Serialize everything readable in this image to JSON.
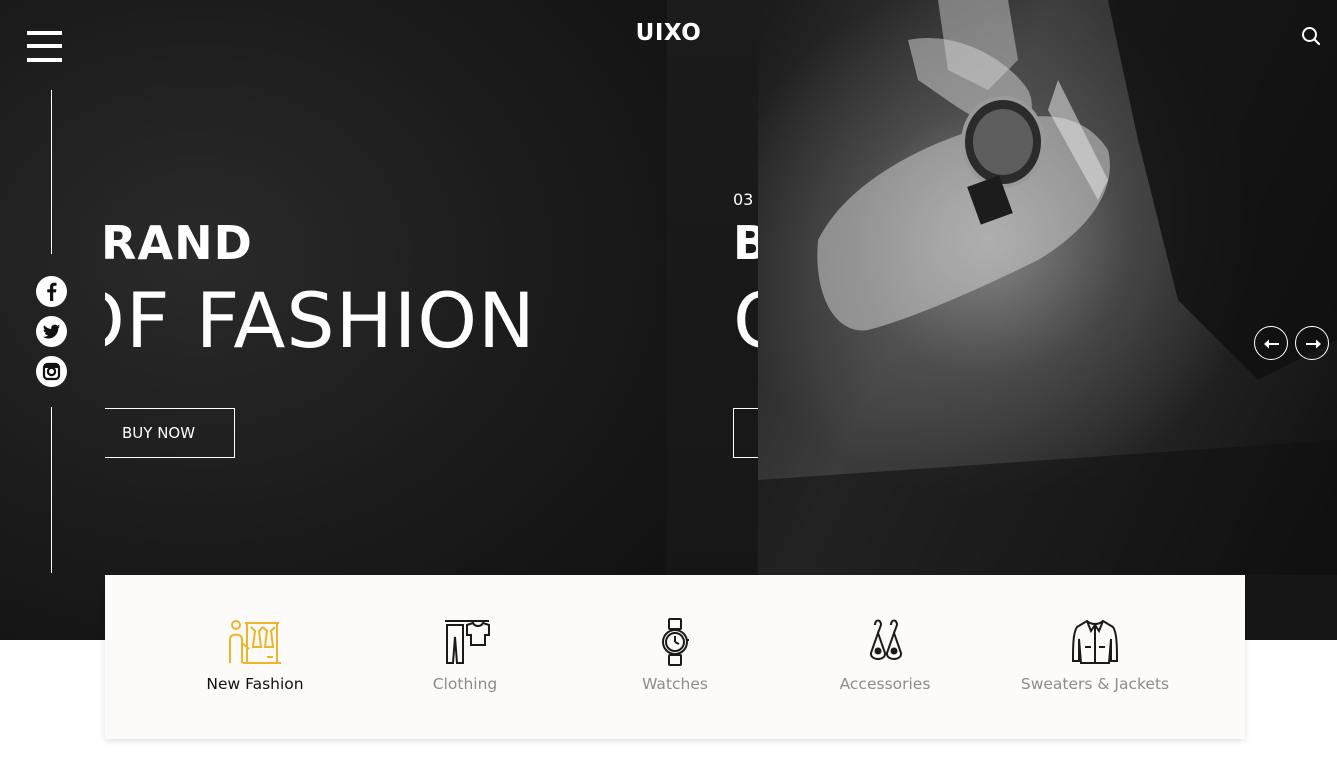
{
  "header": {
    "logo": "UIXO",
    "menu_icon": "hamburger-menu-icon",
    "search_icon": "search-icon"
  },
  "social": [
    {
      "name": "facebook",
      "icon": "facebook-icon"
    },
    {
      "name": "twitter",
      "icon": "twitter-icon"
    },
    {
      "name": "instagram",
      "icon": "instagram-icon"
    }
  ],
  "hero": {
    "slide_active": {
      "line1": "BRAND",
      "line2": "OF FASHION",
      "button_label": "BUY NOW"
    },
    "slide_next": {
      "number": "03",
      "line1": "B",
      "line2": "C"
    },
    "prev_icon": "arrow-left-icon",
    "next_icon": "arrow-right-icon"
  },
  "categories": [
    {
      "label": "New Fashion",
      "icon": "clothing-rack-icon",
      "active": true
    },
    {
      "label": "Clothing",
      "icon": "clothes-hanger-icon",
      "active": false
    },
    {
      "label": "Watches",
      "icon": "wristwatch-icon",
      "active": false
    },
    {
      "label": "Accessories",
      "icon": "earrings-icon",
      "active": false
    },
    {
      "label": "Sweaters & Jackets",
      "icon": "jacket-icon",
      "active": false
    }
  ],
  "colors": {
    "hero_bg": "#151515",
    "accent": "#f0b429",
    "active_label": "#111111",
    "inactive_label": "#8c8c8c",
    "panel_bg": "#fcfbf9"
  }
}
